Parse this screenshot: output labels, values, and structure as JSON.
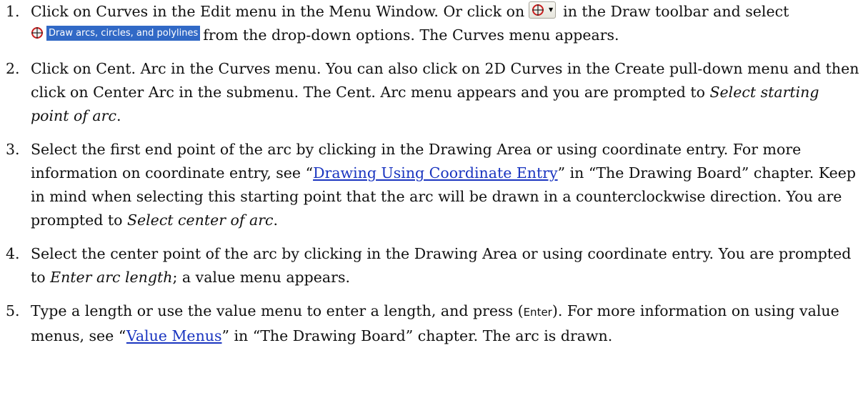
{
  "colors": {
    "link": "#1a35c0",
    "menu_highlight": "#3169c6",
    "icon_red": "#c81e1e"
  },
  "icons": {
    "toolbar_button": "curves-toolbar-icon",
    "menu_option": "arc-circle-icon"
  },
  "steps": [
    {
      "num": "1.",
      "a": "Click on Curves in the Edit menu in the Menu Window. Or click on",
      "b": "in the Draw toolbar and select",
      "option_label": "Draw arcs, circles, and polylines",
      "c": "from the drop-down options. The Curves menu appears."
    },
    {
      "num": "2.",
      "a": "Click on Cent. Arc in the Curves menu. You can also click on 2D Curves in the Create pull-down menu and then click on Center Arc in the submenu. The Cent. Arc menu appears and you are prompted to",
      "prompt": "Select starting point of arc",
      "b": "."
    },
    {
      "num": "3.",
      "a": "Select the first end point of the arc by clicking in the Drawing Area or using coordinate entry. For more information on coordinate entry, see “",
      "link": "Drawing Using Coordinate Entry",
      "b": "” in “The Drawing Board” chapter. Keep in mind when selecting this starting point that the arc will be drawn in a counterclockwise direction. You are prompted to",
      "prompt": "Select center of arc",
      "c": "."
    },
    {
      "num": "4.",
      "a": "Select the center point of the arc by clicking in the Drawing Area or using coordinate entry. You are prompted to",
      "prompt": "Enter arc length",
      "b": "; a value menu appears."
    },
    {
      "num": "5.",
      "a": "Type a length or use the value menu to enter a length, and press (",
      "key": "Enter",
      "b": "). For more information on using value menus, see “",
      "link": "Value Menus",
      "c": "” in “The Drawing Board” chapter. The arc is drawn."
    }
  ]
}
